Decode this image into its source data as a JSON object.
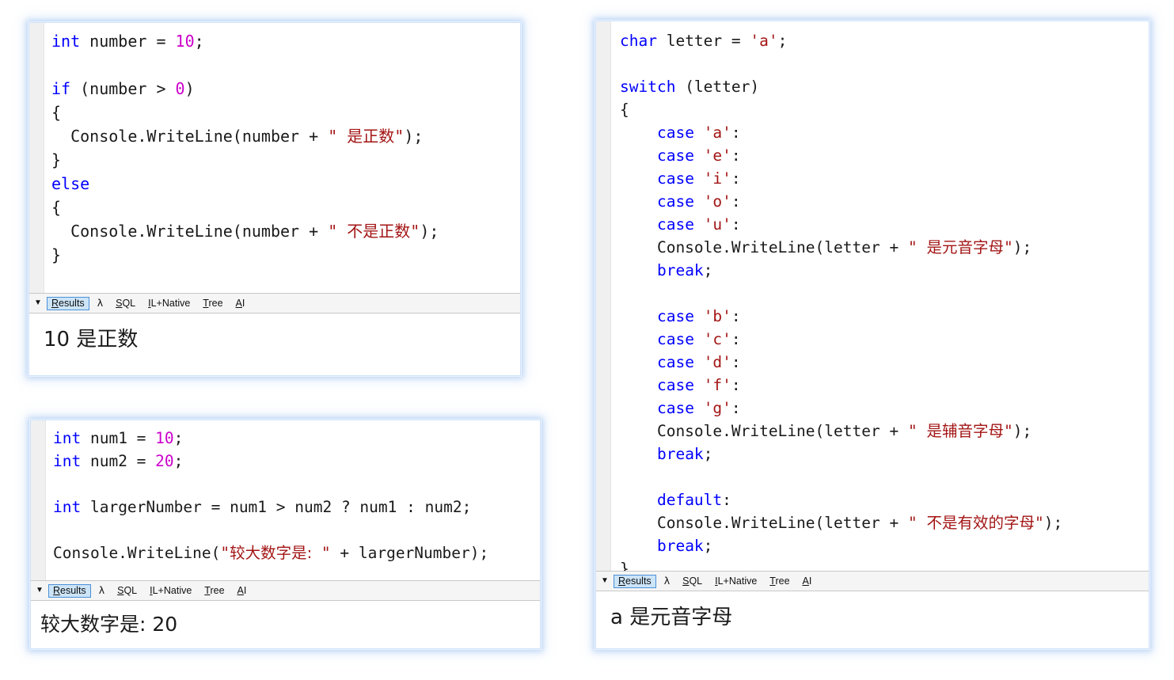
{
  "panels": [
    {
      "id": "if-statement-panel",
      "code_lines": [
        [
          {
            "t": "int",
            "c": "kw"
          },
          {
            "t": " number = ",
            "c": "pl"
          },
          {
            "t": "10",
            "c": "num"
          },
          {
            "t": ";",
            "c": "pl"
          }
        ],
        [],
        [
          {
            "t": "if",
            "c": "kw"
          },
          {
            "t": " (number > ",
            "c": "pl"
          },
          {
            "t": "0",
            "c": "num"
          },
          {
            "t": ")",
            "c": "pl"
          }
        ],
        [
          {
            "t": "{",
            "c": "pl"
          }
        ],
        [
          {
            "t": "  Console.WriteLine(number + ",
            "c": "pl"
          },
          {
            "t": "\" ",
            "c": "str"
          },
          {
            "t": "是正数",
            "c": "cjk"
          },
          {
            "t": "\"",
            "c": "str"
          },
          {
            "t": ");",
            "c": "pl"
          }
        ],
        [
          {
            "t": "}",
            "c": "pl"
          }
        ],
        [
          {
            "t": "else",
            "c": "kw"
          }
        ],
        [
          {
            "t": "{",
            "c": "pl"
          }
        ],
        [
          {
            "t": "  Console.WriteLine(number + ",
            "c": "pl"
          },
          {
            "t": "\" ",
            "c": "str"
          },
          {
            "t": "不是正数",
            "c": "cjk"
          },
          {
            "t": "\"",
            "c": "str"
          },
          {
            "t": ");",
            "c": "pl"
          }
        ],
        [
          {
            "t": "}",
            "c": "pl"
          }
        ]
      ],
      "tabs": [
        {
          "label": "Results",
          "accel": "R",
          "active": true
        },
        {
          "label": "λ",
          "accel": "",
          "active": false,
          "lambda": true
        },
        {
          "label": "SQL",
          "accel": "S",
          "active": false
        },
        {
          "label": "IL+Native",
          "accel": "I",
          "active": false
        },
        {
          "label": "Tree",
          "accel": "T",
          "active": false
        },
        {
          "label": "AI",
          "accel": "A",
          "active": false
        }
      ],
      "output": "10 是正数"
    },
    {
      "id": "ternary-panel",
      "code_lines": [
        [
          {
            "t": "int",
            "c": "kw"
          },
          {
            "t": " num1 = ",
            "c": "pl"
          },
          {
            "t": "10",
            "c": "num"
          },
          {
            "t": ";",
            "c": "pl"
          }
        ],
        [
          {
            "t": "int",
            "c": "kw"
          },
          {
            "t": " num2 = ",
            "c": "pl"
          },
          {
            "t": "20",
            "c": "num"
          },
          {
            "t": ";",
            "c": "pl"
          }
        ],
        [],
        [
          {
            "t": "int",
            "c": "kw"
          },
          {
            "t": " largerNumber = num1 > num2 ? num1 : num2;",
            "c": "pl"
          }
        ],
        [],
        [
          {
            "t": "Console.WriteLine(",
            "c": "pl"
          },
          {
            "t": "\"",
            "c": "str"
          },
          {
            "t": "较大数字是:",
            "c": "cjk"
          },
          {
            "t": " \"",
            "c": "str"
          },
          {
            "t": " + largerNumber);",
            "c": "pl"
          }
        ]
      ],
      "tabs": [
        {
          "label": "Results",
          "accel": "R",
          "active": true
        },
        {
          "label": "λ",
          "accel": "",
          "active": false,
          "lambda": true
        },
        {
          "label": "SQL",
          "accel": "S",
          "active": false
        },
        {
          "label": "IL+Native",
          "accel": "I",
          "active": false
        },
        {
          "label": "Tree",
          "accel": "T",
          "active": false
        },
        {
          "label": "AI",
          "accel": "A",
          "active": false
        }
      ],
      "output": "较大数字是: 20"
    },
    {
      "id": "switch-panel",
      "code_lines": [
        [
          {
            "t": "char",
            "c": "kw"
          },
          {
            "t": " letter = ",
            "c": "pl"
          },
          {
            "t": "'a'",
            "c": "str"
          },
          {
            "t": ";",
            "c": "pl"
          }
        ],
        [],
        [
          {
            "t": "switch",
            "c": "kw"
          },
          {
            "t": " (letter)",
            "c": "pl"
          }
        ],
        [
          {
            "t": "{",
            "c": "pl"
          }
        ],
        [
          {
            "t": "    ",
            "c": "pl"
          },
          {
            "t": "case",
            "c": "kw"
          },
          {
            "t": " ",
            "c": "pl"
          },
          {
            "t": "'a'",
            "c": "str"
          },
          {
            "t": ":",
            "c": "pl"
          }
        ],
        [
          {
            "t": "    ",
            "c": "pl"
          },
          {
            "t": "case",
            "c": "kw"
          },
          {
            "t": " ",
            "c": "pl"
          },
          {
            "t": "'e'",
            "c": "str"
          },
          {
            "t": ":",
            "c": "pl"
          }
        ],
        [
          {
            "t": "    ",
            "c": "pl"
          },
          {
            "t": "case",
            "c": "kw"
          },
          {
            "t": " ",
            "c": "pl"
          },
          {
            "t": "'i'",
            "c": "str"
          },
          {
            "t": ":",
            "c": "pl"
          }
        ],
        [
          {
            "t": "    ",
            "c": "pl"
          },
          {
            "t": "case",
            "c": "kw"
          },
          {
            "t": " ",
            "c": "pl"
          },
          {
            "t": "'o'",
            "c": "str"
          },
          {
            "t": ":",
            "c": "pl"
          }
        ],
        [
          {
            "t": "    ",
            "c": "pl"
          },
          {
            "t": "case",
            "c": "kw"
          },
          {
            "t": " ",
            "c": "pl"
          },
          {
            "t": "'u'",
            "c": "str"
          },
          {
            "t": ":",
            "c": "pl"
          }
        ],
        [
          {
            "t": "    Console.WriteLine(letter + ",
            "c": "pl"
          },
          {
            "t": "\" ",
            "c": "str"
          },
          {
            "t": "是元音字母",
            "c": "cjk"
          },
          {
            "t": "\"",
            "c": "str"
          },
          {
            "t": ");",
            "c": "pl"
          }
        ],
        [
          {
            "t": "    ",
            "c": "pl"
          },
          {
            "t": "break",
            "c": "kw"
          },
          {
            "t": ";",
            "c": "pl"
          }
        ],
        [],
        [
          {
            "t": "    ",
            "c": "pl"
          },
          {
            "t": "case",
            "c": "kw"
          },
          {
            "t": " ",
            "c": "pl"
          },
          {
            "t": "'b'",
            "c": "str"
          },
          {
            "t": ":",
            "c": "pl"
          }
        ],
        [
          {
            "t": "    ",
            "c": "pl"
          },
          {
            "t": "case",
            "c": "kw"
          },
          {
            "t": " ",
            "c": "pl"
          },
          {
            "t": "'c'",
            "c": "str"
          },
          {
            "t": ":",
            "c": "pl"
          }
        ],
        [
          {
            "t": "    ",
            "c": "pl"
          },
          {
            "t": "case",
            "c": "kw"
          },
          {
            "t": " ",
            "c": "pl"
          },
          {
            "t": "'d'",
            "c": "str"
          },
          {
            "t": ":",
            "c": "pl"
          }
        ],
        [
          {
            "t": "    ",
            "c": "pl"
          },
          {
            "t": "case",
            "c": "kw"
          },
          {
            "t": " ",
            "c": "pl"
          },
          {
            "t": "'f'",
            "c": "str"
          },
          {
            "t": ":",
            "c": "pl"
          }
        ],
        [
          {
            "t": "    ",
            "c": "pl"
          },
          {
            "t": "case",
            "c": "kw"
          },
          {
            "t": " ",
            "c": "pl"
          },
          {
            "t": "'g'",
            "c": "str"
          },
          {
            "t": ":",
            "c": "pl"
          }
        ],
        [
          {
            "t": "    Console.WriteLine(letter + ",
            "c": "pl"
          },
          {
            "t": "\" ",
            "c": "str"
          },
          {
            "t": "是辅音字母",
            "c": "cjk"
          },
          {
            "t": "\"",
            "c": "str"
          },
          {
            "t": ");",
            "c": "pl"
          }
        ],
        [
          {
            "t": "    ",
            "c": "pl"
          },
          {
            "t": "break",
            "c": "kw"
          },
          {
            "t": ";",
            "c": "pl"
          }
        ],
        [],
        [
          {
            "t": "    ",
            "c": "pl"
          },
          {
            "t": "default",
            "c": "kw"
          },
          {
            "t": ":",
            "c": "pl"
          }
        ],
        [
          {
            "t": "    Console.WriteLine(letter + ",
            "c": "pl"
          },
          {
            "t": "\" ",
            "c": "str"
          },
          {
            "t": "不是有效的字母",
            "c": "cjk"
          },
          {
            "t": "\"",
            "c": "str"
          },
          {
            "t": ");",
            "c": "pl"
          }
        ],
        [
          {
            "t": "    ",
            "c": "pl"
          },
          {
            "t": "break",
            "c": "kw"
          },
          {
            "t": ";",
            "c": "pl"
          }
        ],
        [
          {
            "t": "}",
            "c": "pl"
          }
        ]
      ],
      "tabs": [
        {
          "label": "Results",
          "accel": "R",
          "active": true
        },
        {
          "label": "λ",
          "accel": "",
          "active": false,
          "lambda": true
        },
        {
          "label": "SQL",
          "accel": "S",
          "active": false
        },
        {
          "label": "IL+Native",
          "accel": "I",
          "active": false
        },
        {
          "label": "Tree",
          "accel": "T",
          "active": false
        },
        {
          "label": "AI",
          "accel": "A",
          "active": false
        }
      ],
      "output": "a 是元音字母"
    }
  ],
  "colors": {
    "keyword": "#0000ff",
    "number": "#cc00cc",
    "string": "#a31515",
    "text": "#1a1a1a",
    "tab_active_bg": "#cce4f7",
    "tab_active_border": "#4a90d9",
    "tabstrip_bg": "#f5f5f5",
    "gutter": "#f0f0f0",
    "panel_glow": "#b4d2f5"
  },
  "caret_glyph": "▼"
}
